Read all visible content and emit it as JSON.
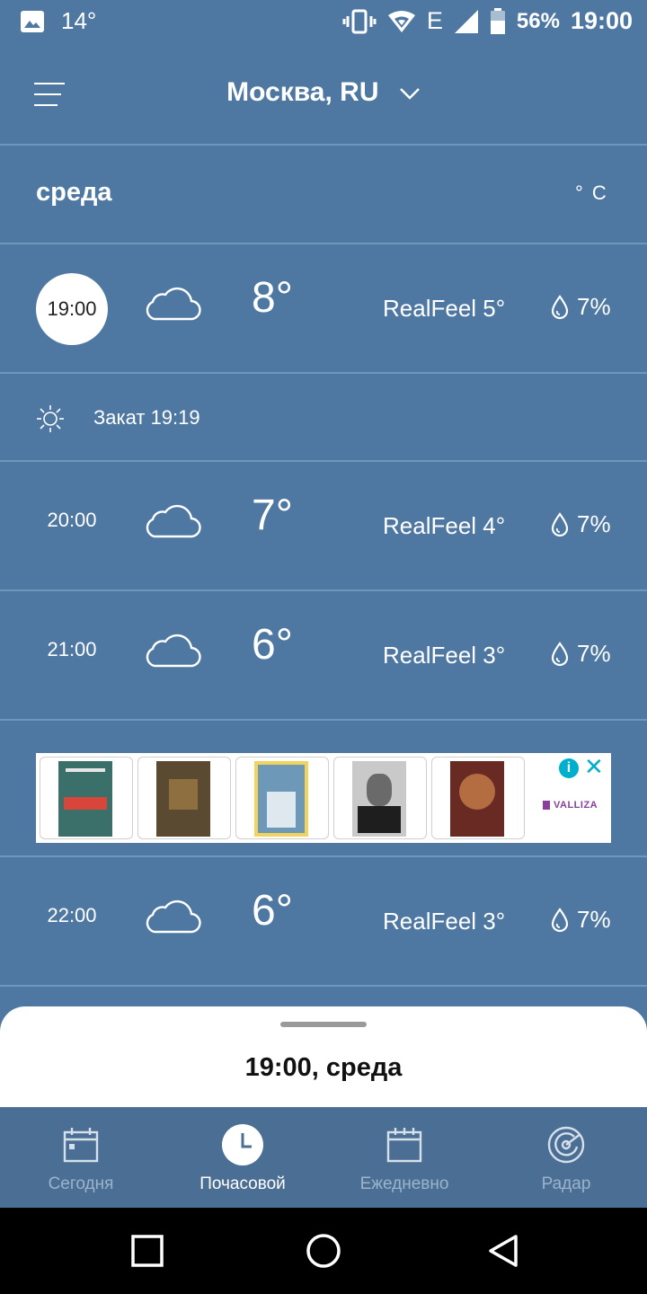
{
  "status_bar": {
    "temperature": "14°",
    "network": "E",
    "battery": "56%",
    "time": "19:00"
  },
  "header": {
    "city": "Москва, RU",
    "menu_icon": "hamburger-menu-icon",
    "dropdown_icon": "chevron-down-icon"
  },
  "day": {
    "label": "среда",
    "unit": "° C"
  },
  "hours": [
    {
      "time": "19:00",
      "icon": "cloud-icon",
      "temp": "8°",
      "realfeel": "RealFeel 5°",
      "precip": "7%"
    },
    {
      "time": "20:00",
      "icon": "cloud-icon",
      "temp": "7°",
      "realfeel": "RealFeel 4°",
      "precip": "7%"
    },
    {
      "time": "21:00",
      "icon": "cloud-icon",
      "temp": "6°",
      "realfeel": "RealFeel 3°",
      "precip": "7%"
    },
    {
      "time": "22:00",
      "icon": "cloud-icon",
      "temp": "6°",
      "realfeel": "RealFeel 3°",
      "precip": "7%"
    }
  ],
  "sunset": {
    "icon": "sun-icon",
    "label": "Закат 19:19"
  },
  "ad": {
    "brand": "VALLIZA",
    "books": [
      {
        "color": "#3b6f6a",
        "accent": "#d8453a"
      },
      {
        "color": "#5a4a32",
        "accent": "#b08a4a"
      },
      {
        "color": "#6e98b8",
        "accent": "#f2d35c"
      },
      {
        "color": "#c9c9c9",
        "accent": "#1e1e1e"
      },
      {
        "color": "#6a2a24",
        "accent": "#d38a4f"
      }
    ]
  },
  "sheet": {
    "title": "19:00, среда"
  },
  "tabs": [
    {
      "label": "Сегодня",
      "icon": "calendar-today-icon",
      "active": false
    },
    {
      "label": "Почасовой",
      "icon": "clock-icon",
      "active": true
    },
    {
      "label": "Ежедневно",
      "icon": "calendar-icon",
      "active": false
    },
    {
      "label": "Радар",
      "icon": "radar-icon",
      "active": false
    }
  ],
  "colors": {
    "background": "#4e78a2",
    "tabbar": "#4b6f94",
    "divider": "#7296bb",
    "ad_accent": "#00aecd"
  }
}
